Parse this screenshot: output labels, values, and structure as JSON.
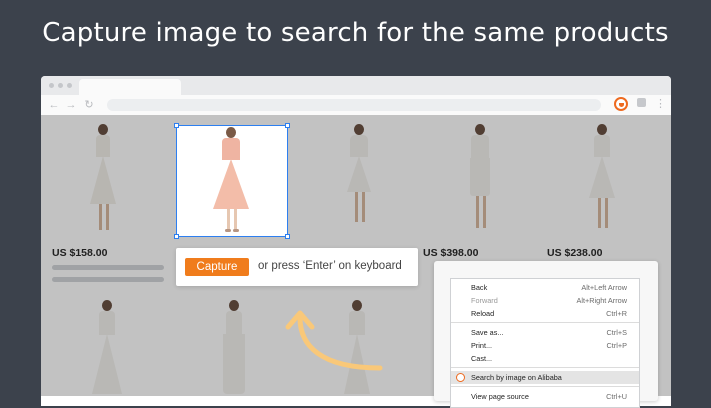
{
  "headline": "Capture image to search for the same products",
  "browser": {
    "icons": [
      "back-arrow-icon",
      "forward-arrow-icon",
      "reload-icon",
      "extension-icon",
      "puzzle-icon",
      "kebab-menu-icon"
    ]
  },
  "products": {
    "prices": {
      "p1": "US $158.00",
      "p4": "US $398.00",
      "p5": "US $238.00"
    }
  },
  "capture": {
    "button_label": "Capture",
    "hint": "or press ‘Enter’ on keyboard"
  },
  "context_menu": {
    "items": [
      {
        "label": "Back",
        "shortcut": "Alt+Left Arrow"
      },
      {
        "label": "Forward",
        "shortcut": "Alt+Right Arrow"
      },
      {
        "label": "Reload",
        "shortcut": "Ctrl+R"
      },
      {
        "label": "Save as...",
        "shortcut": "Ctrl+S"
      },
      {
        "label": "Print...",
        "shortcut": "Ctrl+P"
      },
      {
        "label": "Cast...",
        "shortcut": ""
      },
      {
        "label": "Search by image on Alibaba",
        "shortcut": ""
      },
      {
        "label": "View page source",
        "shortcut": "Ctrl+U"
      }
    ]
  },
  "colors": {
    "accent": "#f07c1c",
    "background": "#3c424c",
    "arrow": "#f9c879"
  }
}
